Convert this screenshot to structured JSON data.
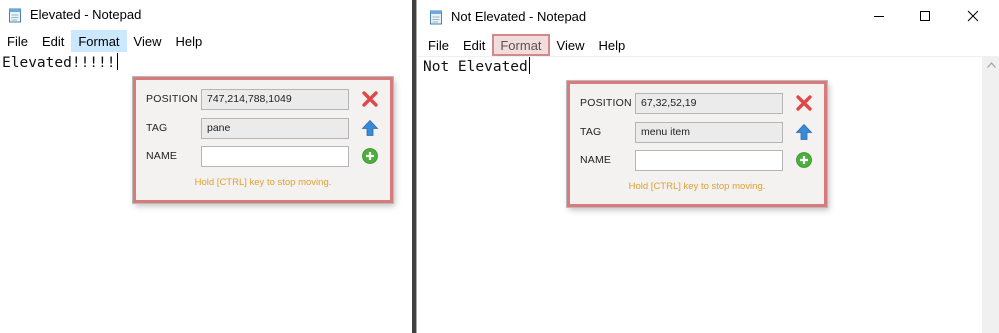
{
  "windows": {
    "left": {
      "title": "Elevated - Notepad",
      "menu": [
        "File",
        "Edit",
        "Format",
        "View",
        "Help"
      ],
      "editor_text": "Elevated!!!!!",
      "inspector": {
        "position_label": "POSITION",
        "position_value": "747,214,788,1049",
        "tag_label": "TAG",
        "tag_value": "pane",
        "name_label": "NAME",
        "name_value": "",
        "hint": "Hold [CTRL] key to stop moving."
      }
    },
    "right": {
      "title": "Not Elevated - Notepad",
      "menu": [
        "File",
        "Edit",
        "Format",
        "View",
        "Help"
      ],
      "editor_text": "Not Elevated",
      "inspector": {
        "position_label": "POSITION",
        "position_value": "67,32,52,19",
        "tag_label": "TAG",
        "tag_value": "menu item",
        "name_label": "NAME",
        "name_value": "",
        "hint": "Hold [CTRL] key to stop moving."
      }
    }
  },
  "colors": {
    "inspector_border": "#d87b7b",
    "hint_text": "#e0a030",
    "menu_hover_left": "#cce8ff",
    "menu_hover_right": "#f2dcdc",
    "close_icon": "#e04848",
    "up_icon": "#3a8ad8",
    "add_icon": "#4cae3c"
  },
  "icons": {
    "app": "notepad-icon",
    "minimize": "minimize-icon",
    "maximize": "maximize-icon",
    "close": "close-icon",
    "inspector_close": "red-x-icon",
    "inspector_parent": "blue-up-arrow-icon",
    "inspector_add": "green-plus-icon"
  }
}
